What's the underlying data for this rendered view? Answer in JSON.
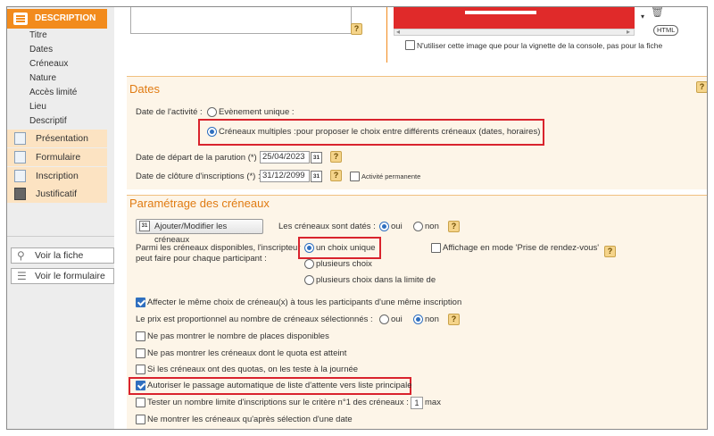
{
  "sidebar": {
    "header_label": "DESCRIPTION",
    "subitems": [
      "Titre",
      "Dates",
      "Créneaux",
      "Nature",
      "Accès limité",
      "Lieu",
      "Descriptif"
    ],
    "groups": [
      "Présentation",
      "Formulaire",
      "Inscription",
      "Justificatif"
    ],
    "buttons": [
      "Voir la fiche",
      "Voir le formulaire"
    ]
  },
  "top": {
    "html_label": "HTML",
    "thumb_only_label": "N'utiliser cette image que pour la vignette de la console, pas pour la fiche",
    "qmark": "?",
    "trash_glyph": "🗑",
    "arrow_left": "◂",
    "arrow_right": "▸",
    "arrow_down": "▾"
  },
  "dates": {
    "title": "Dates",
    "activity_label": "Date de l'activité :",
    "single_event_label": "Evènement unique :",
    "multi_slots_label": "Créneaux multiples :",
    "multi_slots_desc": "pour proposer le choix entre différents créneaux (dates, horaires)",
    "start_label": "Date de départ de la parution (*) :",
    "start_value": "25/04/2023",
    "end_label": "Date de clôture d'inscriptions (*) :",
    "end_value": "31/12/2099",
    "permanent_label": "Activité permanente",
    "cal_text": "31"
  },
  "slots": {
    "title": "Paramétrage des créneaux",
    "add_button": "Ajouter/Modifier les créneaux",
    "dated_label": "Les créneaux sont datés :",
    "yes": "oui",
    "no": "non",
    "choice_intro_1": "Parmi les créneaux disponibles, l'inscripteur",
    "choice_intro_2": "peut faire pour chaque participant :",
    "single_choice": "un choix unique",
    "multi_choice": "plusieurs choix",
    "multi_choice_limit": "plusieurs choix dans la limite de",
    "rdv_label": "Affichage en mode 'Prise de rendez-vous'",
    "same_choice": "Affecter le même choix de créneau(x) à tous les participants d'une même inscription",
    "price_prop": "Le prix est proportionnel au nombre de créneaux sélectionnés :",
    "hide_places": "Ne pas montrer le nombre de places disponibles",
    "hide_quota": "Ne pas montrer les créneaux dont le quota est atteint",
    "quota_day": "Si les créneaux ont des quotas, on les teste à la journée",
    "auto_waitlist": "Autoriser le passage automatique de liste d'attente vers liste principale",
    "test_limit": "Tester un nombre limite d'inscriptions sur le critère n°1 des créneaux :",
    "test_limit_value": "1",
    "test_limit_suffix": "max",
    "show_after_date": "Ne montrer les créneaux qu'après sélection d'une date"
  },
  "colors": {
    "accent": "#f28b1d",
    "highlight_box": "#d9232d",
    "checked": "#2f6fbf"
  }
}
